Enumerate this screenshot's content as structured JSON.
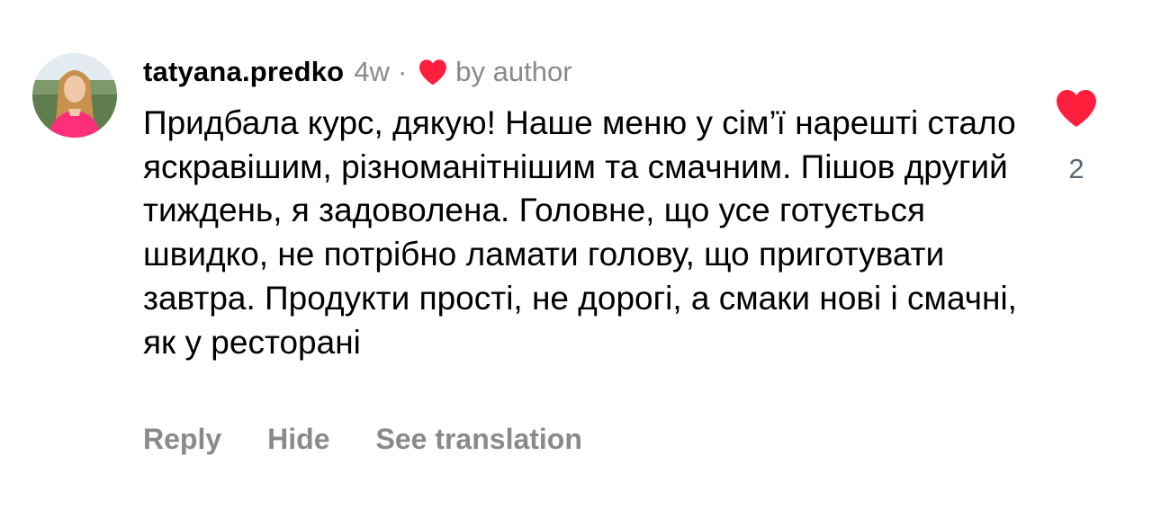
{
  "comment": {
    "username": "tatyana.predko",
    "time": "4w",
    "separator": "·",
    "liked_by_author_label": "by author",
    "text": "Придбала курс, дякую! Наше меню у сім’ї нарешті стало яскравішим, різноманітнішим та смачним. Пішов другий тиждень, я задоволена. Головне, що усе готується швидко, не потрібно ламати голову, що приготувати завтра. Продукти прості, не дорогі, а смаки нові і смачні, як у ресторані",
    "like_count": "2"
  },
  "actions": {
    "reply": "Reply",
    "hide": "Hide",
    "see_translation": "See translation"
  },
  "icons": {
    "author_heart": "heart-icon",
    "like_heart": "heart-icon",
    "avatar": "profile-photo"
  },
  "colors": {
    "heart": "#ff1f3d",
    "secondary_text": "#8a8a8a",
    "like_count": "#5a6775"
  }
}
